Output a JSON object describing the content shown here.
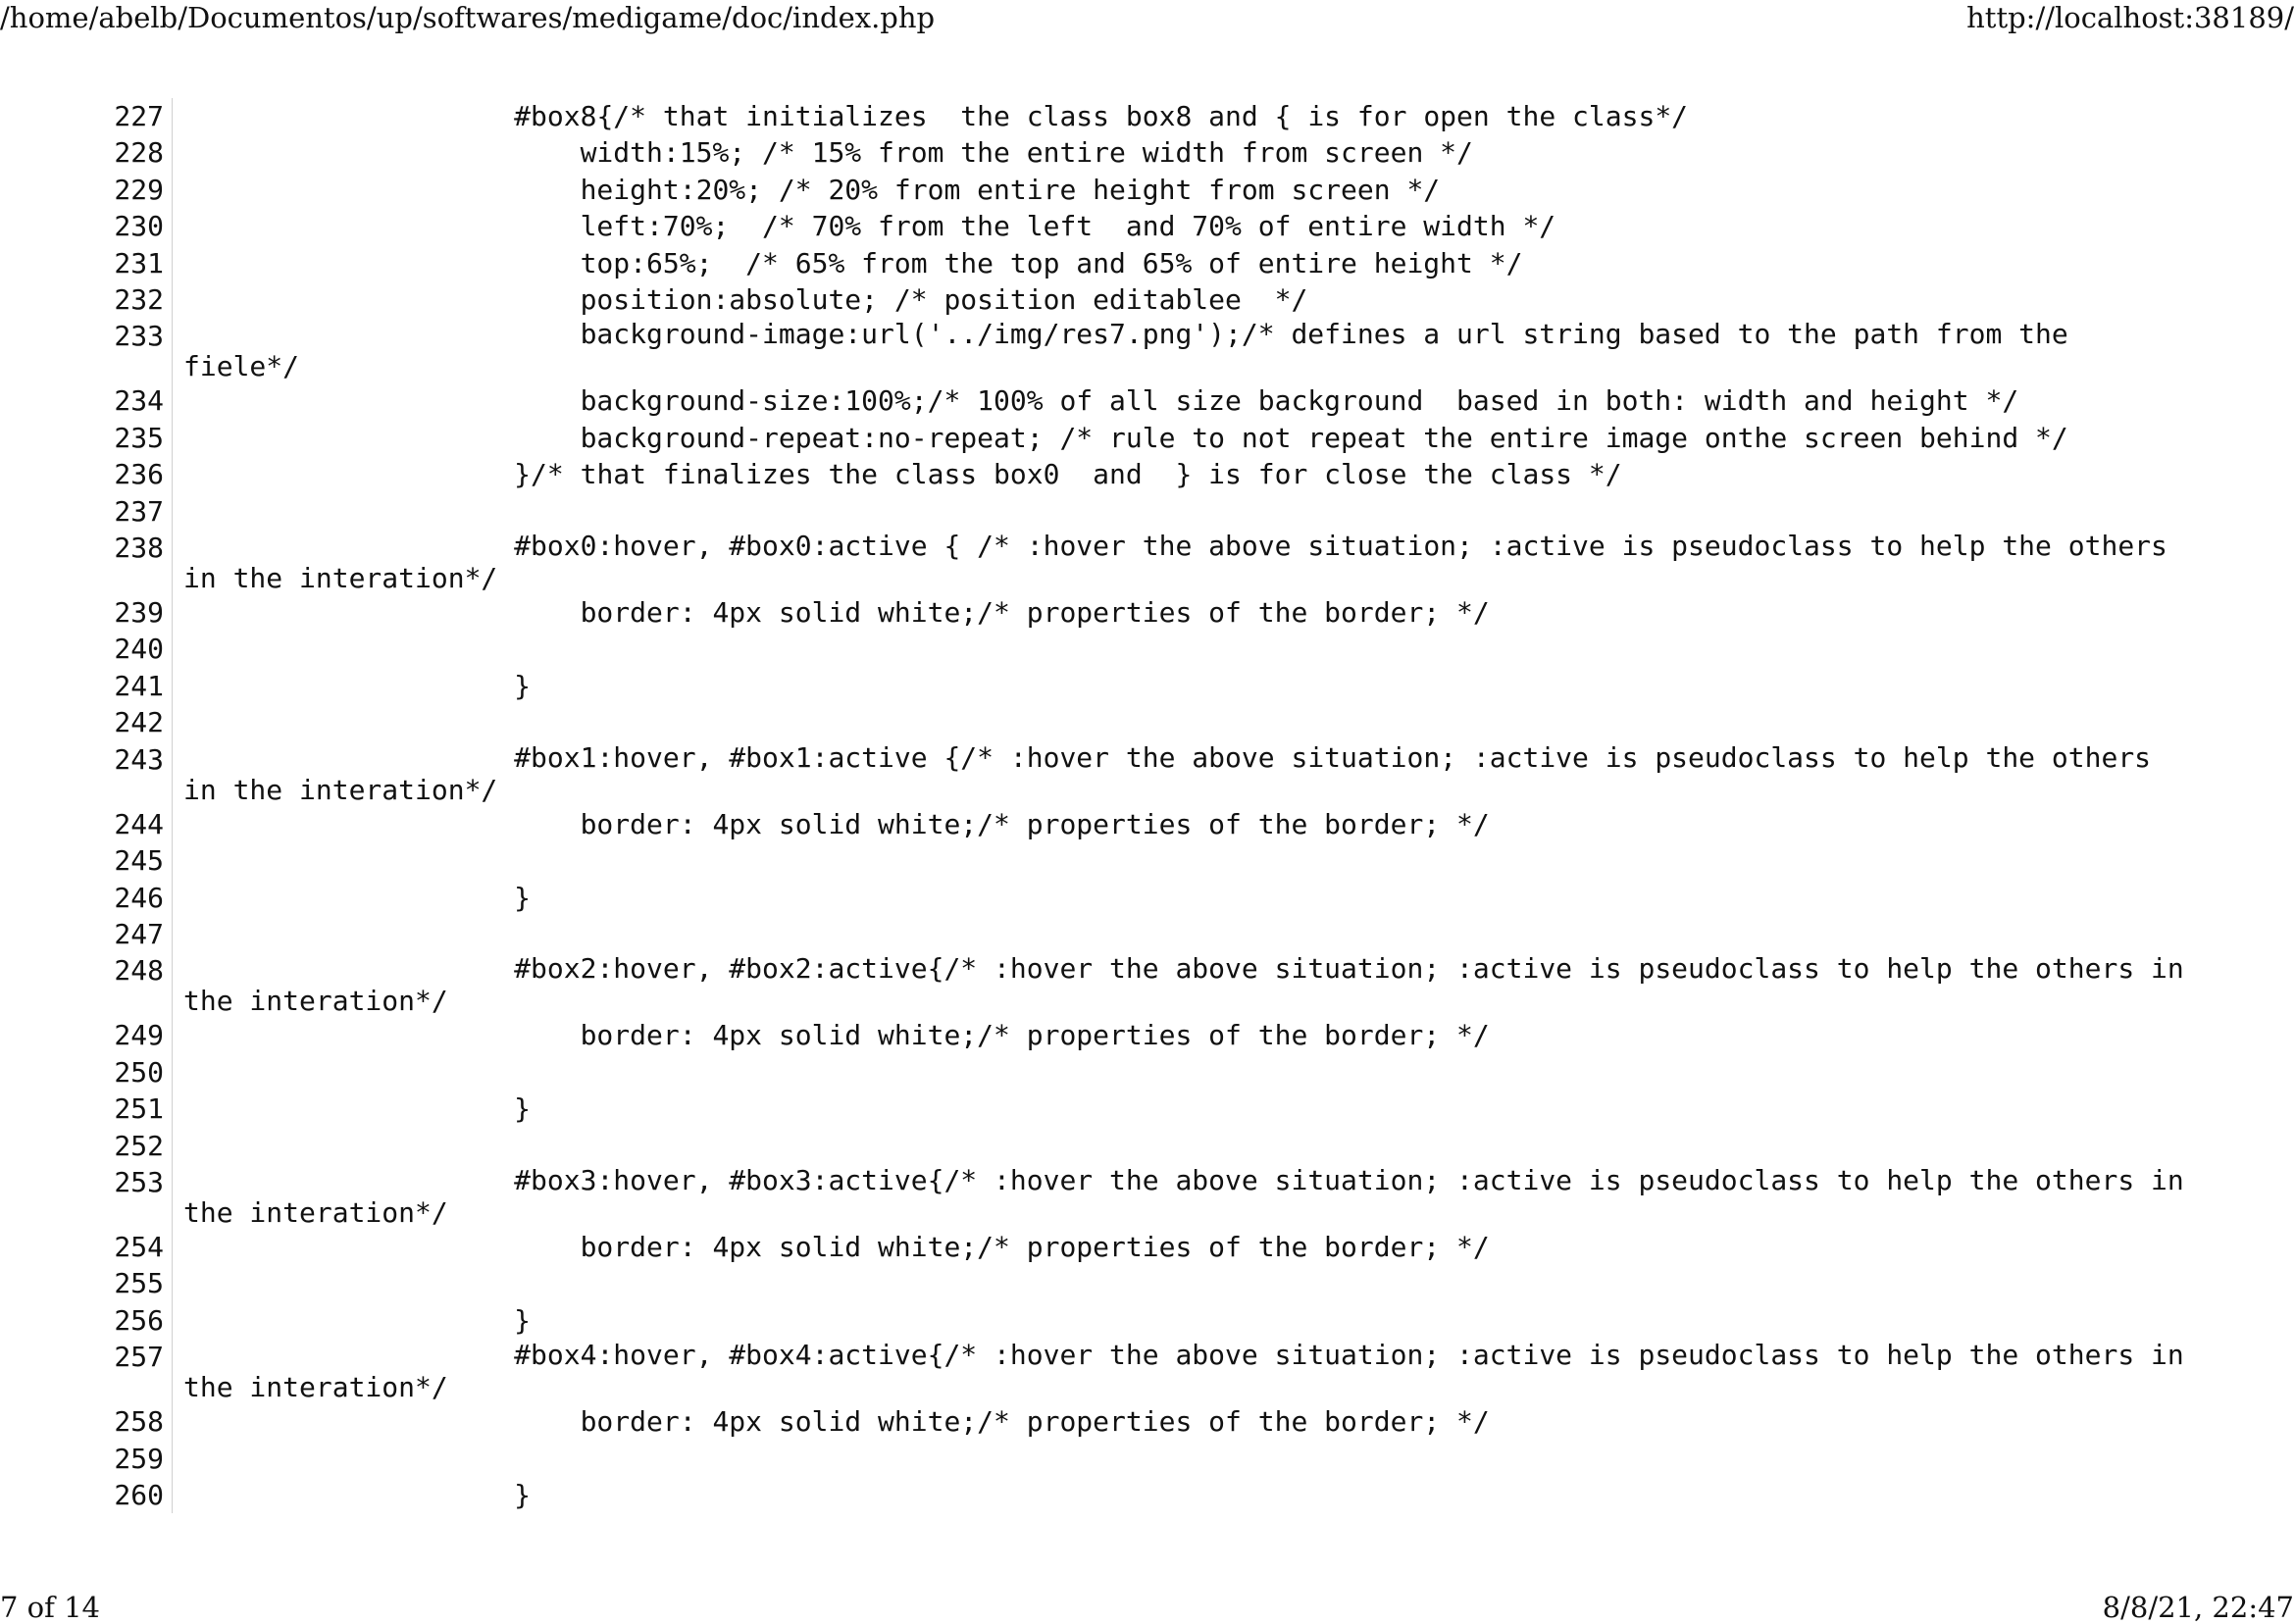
{
  "header": {
    "path": "/home/abelb/Documentos/up/softwares/medigame/doc/index.php",
    "url": "http://localhost:38189/"
  },
  "footer": {
    "page": "7 of 14",
    "datetime": "8/8/21, 22:47"
  },
  "code": {
    "lines": [
      {
        "num": "227",
        "text": "                    #box8{/* that initializes  the class box8 and { is for open the class*/"
      },
      {
        "num": "228",
        "text": "                        width:15%; /* 15% from the entire width from screen */"
      },
      {
        "num": "229",
        "text": "                        height:20%; /* 20% from entire height from screen */"
      },
      {
        "num": "230",
        "text": "                        left:70%;  /* 70% from the left  and 70% of entire width */"
      },
      {
        "num": "231",
        "text": "                        top:65%;  /* 65% from the top and 65% of entire height */"
      },
      {
        "num": "232",
        "text": "                        position:absolute; /* position editablee  */"
      },
      {
        "num": "233",
        "text": "                        background-image:url('../img/res7.png');/* defines a url string based to the path from the fiele*/"
      },
      {
        "num": "234",
        "text": "                        background-size:100%;/* 100% of all size background  based in both: width and height */"
      },
      {
        "num": "235",
        "text": "                        background-repeat:no-repeat; /* rule to not repeat the entire image onthe screen behind */"
      },
      {
        "num": "236",
        "text": "                    }/* that finalizes the class box0  and  } is for close the class */"
      },
      {
        "num": "237",
        "text": ""
      },
      {
        "num": "238",
        "text": "                    #box0:hover, #box0:active { /* :hover the above situation; :active is pseudoclass to help the others in the interation*/"
      },
      {
        "num": "239",
        "text": "                        border: 4px solid white;/* properties of the border; */"
      },
      {
        "num": "240",
        "text": ""
      },
      {
        "num": "241",
        "text": "                    }"
      },
      {
        "num": "242",
        "text": ""
      },
      {
        "num": "243",
        "text": "                    #box1:hover, #box1:active {/* :hover the above situation; :active is pseudoclass to help the others in the interation*/"
      },
      {
        "num": "244",
        "text": "                        border: 4px solid white;/* properties of the border; */"
      },
      {
        "num": "245",
        "text": ""
      },
      {
        "num": "246",
        "text": "                    }"
      },
      {
        "num": "247",
        "text": ""
      },
      {
        "num": "248",
        "text": "                    #box2:hover, #box2:active{/* :hover the above situation; :active is pseudoclass to help the others in the interation*/"
      },
      {
        "num": "249",
        "text": "                        border: 4px solid white;/* properties of the border; */"
      },
      {
        "num": "250",
        "text": ""
      },
      {
        "num": "251",
        "text": "                    }"
      },
      {
        "num": "252",
        "text": ""
      },
      {
        "num": "253",
        "text": "                    #box3:hover, #box3:active{/* :hover the above situation; :active is pseudoclass to help the others in the interation*/"
      },
      {
        "num": "254",
        "text": "                        border: 4px solid white;/* properties of the border; */"
      },
      {
        "num": "255",
        "text": ""
      },
      {
        "num": "256",
        "text": "                    }"
      },
      {
        "num": "257",
        "text": "                    #box4:hover, #box4:active{/* :hover the above situation; :active is pseudoclass to help the others in the interation*/"
      },
      {
        "num": "258",
        "text": "                        border: 4px solid white;/* properties of the border; */"
      },
      {
        "num": "259",
        "text": ""
      },
      {
        "num": "260",
        "text": "                    }"
      }
    ]
  }
}
